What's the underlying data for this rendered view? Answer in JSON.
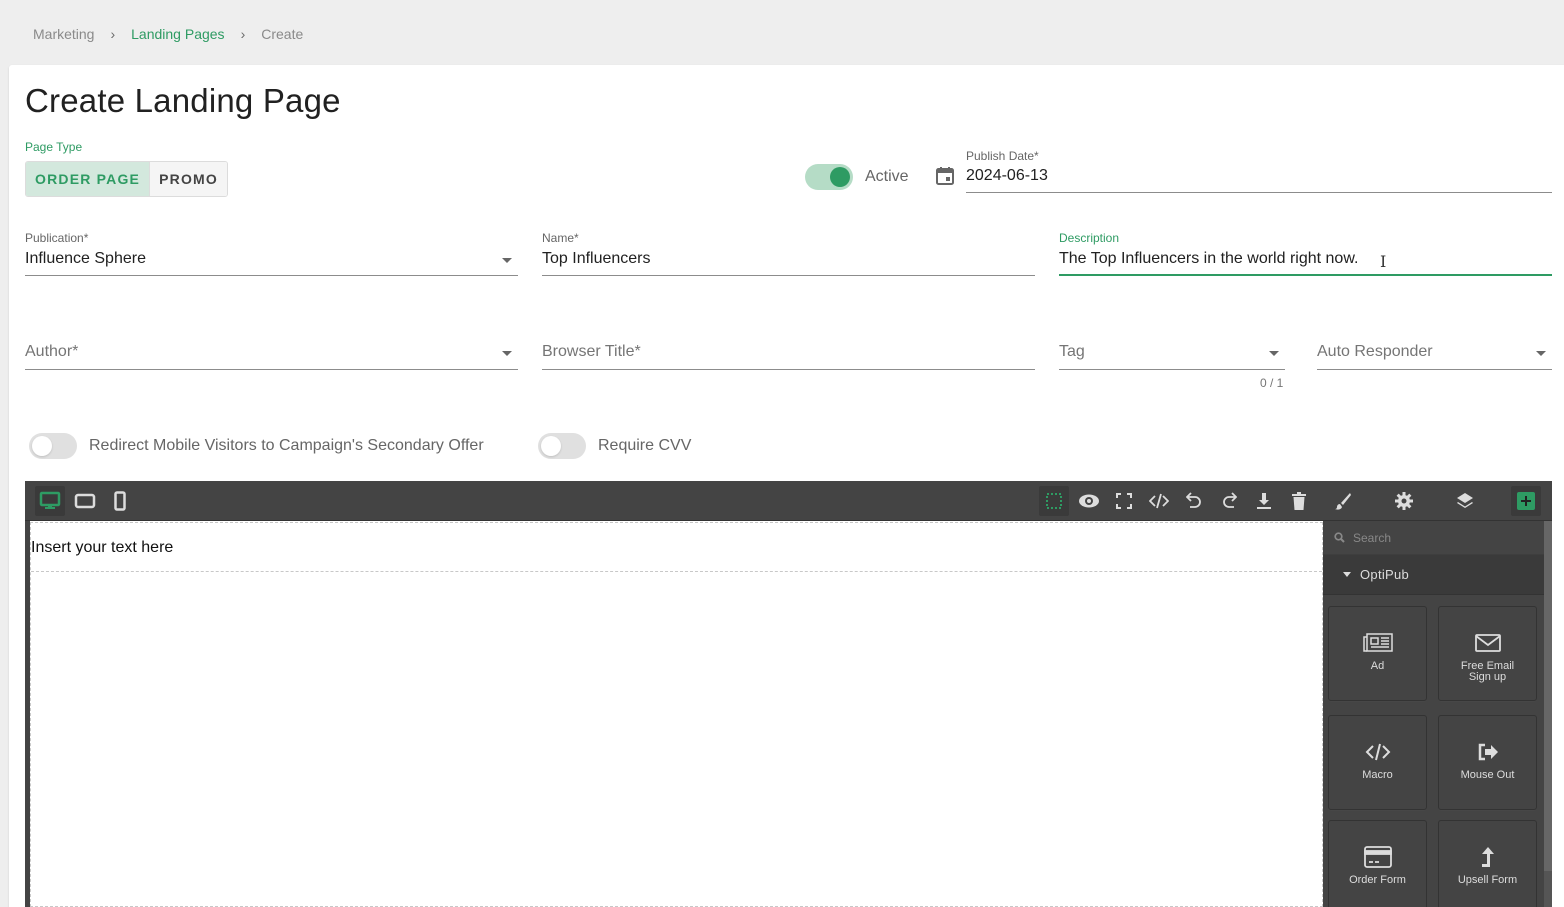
{
  "breadcrumb": {
    "items": [
      {
        "label": "Marketing"
      },
      {
        "label": "Landing Pages"
      },
      {
        "label": "Create"
      }
    ],
    "separator": "›"
  },
  "page": {
    "title": "Create Landing Page"
  },
  "page_type": {
    "label": "Page Type",
    "options": [
      "ORDER PAGE",
      "PROMO"
    ],
    "selected": "ORDER PAGE"
  },
  "active_switch": {
    "label": "Active",
    "on": true
  },
  "publish_date": {
    "label": "Publish Date*",
    "value": "2024-06-13"
  },
  "publication": {
    "label": "Publication*",
    "value": "Influence Sphere"
  },
  "name": {
    "label": "Name*",
    "value": "Top Influencers"
  },
  "description": {
    "label": "Description",
    "value": "The Top Influencers in the world right now."
  },
  "author": {
    "placeholder": "Author*"
  },
  "browser_title": {
    "placeholder": "Browser Title*"
  },
  "tag": {
    "placeholder": "Tag",
    "counter": "0 / 1"
  },
  "auto_responder": {
    "placeholder": "Auto Responder"
  },
  "redirect_switch": {
    "label": "Redirect Mobile Visitors to Campaign's Secondary Offer",
    "on": false
  },
  "cvv_switch": {
    "label": "Require CVV",
    "on": false
  },
  "editor": {
    "devices": [
      "desktop-icon",
      "tablet-icon",
      "mobile-icon"
    ],
    "active_device": "desktop",
    "toolbar_icons": [
      "sw-visibility-icon",
      "preview-icon",
      "fullscreen-icon",
      "code-icon",
      "undo-icon",
      "redo-icon",
      "download-icon",
      "trash-icon"
    ],
    "panel_icons": [
      "style-manager-icon",
      "settings-icon",
      "layers-icon",
      "blocks-icon"
    ],
    "canvas_text": "Insert your text here",
    "search_placeholder": "Search",
    "category": "OptiPub",
    "blocks": [
      {
        "label": "Ad",
        "icon": "newspaper-icon"
      },
      {
        "label": "Free Email Sign up",
        "icon": "envelope-icon"
      },
      {
        "label": "Macro",
        "icon": "code-icon"
      },
      {
        "label": "Mouse Out",
        "icon": "sign-out-icon"
      },
      {
        "label": "Order Form",
        "icon": "credit-card-icon"
      },
      {
        "label": "Upsell Form",
        "icon": "level-up-icon"
      }
    ]
  },
  "colors": {
    "accent": "#2e9b63",
    "editor_bg": "#444444",
    "page_bg": "#eeeeee"
  }
}
